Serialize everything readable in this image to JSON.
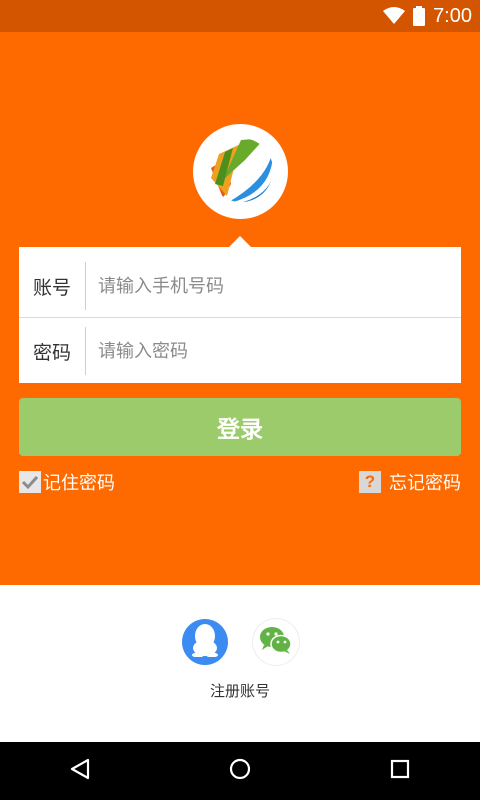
{
  "status_bar": {
    "time": "7:00",
    "icons": [
      "wifi-icon",
      "battery-icon"
    ]
  },
  "logo": {
    "icon": "app-logo-icon"
  },
  "form": {
    "account_label": "账号",
    "account_placeholder": "请输入手机号码",
    "account_value": "",
    "password_label": "密码",
    "password_placeholder": "请输入密码",
    "password_value": ""
  },
  "login_button": {
    "label": "登录"
  },
  "remember_password": {
    "label": "记住密码",
    "checked": true
  },
  "forgot_password": {
    "icon_text": "?",
    "label": "忘记密码"
  },
  "social_login": [
    {
      "name": "qq",
      "icon": "qq-icon"
    },
    {
      "name": "wechat",
      "icon": "wechat-icon"
    }
  ],
  "register": {
    "label": "注册账号"
  },
  "nav_bar": {
    "buttons": [
      "back-icon",
      "home-icon",
      "recents-icon"
    ]
  },
  "colors": {
    "accent_orange": "#fe6900",
    "status_bar": "#d45500",
    "login_button": "#9bcb6a",
    "qq_blue": "#3c8bf0",
    "wechat_green": "#62b346"
  }
}
